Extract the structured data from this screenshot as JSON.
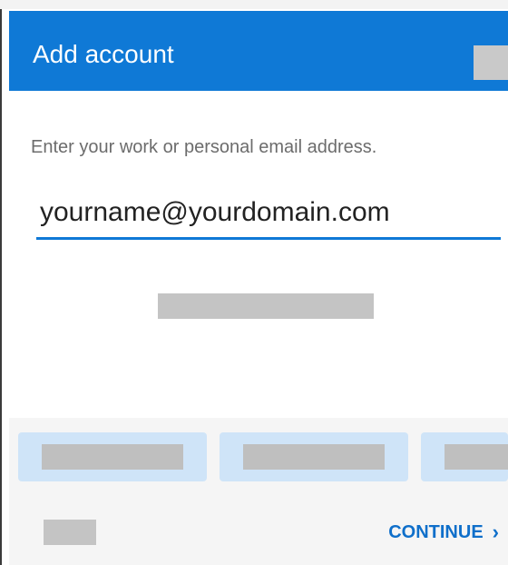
{
  "header": {
    "title": "Add account"
  },
  "form": {
    "instruction": "Enter your work or personal email address.",
    "email_value": "yourname@yourdomain.com"
  },
  "footer": {
    "continue_label": "CONTINUE",
    "continue_icon": "chevron-right-icon"
  },
  "colors": {
    "accent": "#0f79d6",
    "tile": "#cfe4f8",
    "redaction": "#c4c4c4",
    "link": "#0f6fca"
  }
}
